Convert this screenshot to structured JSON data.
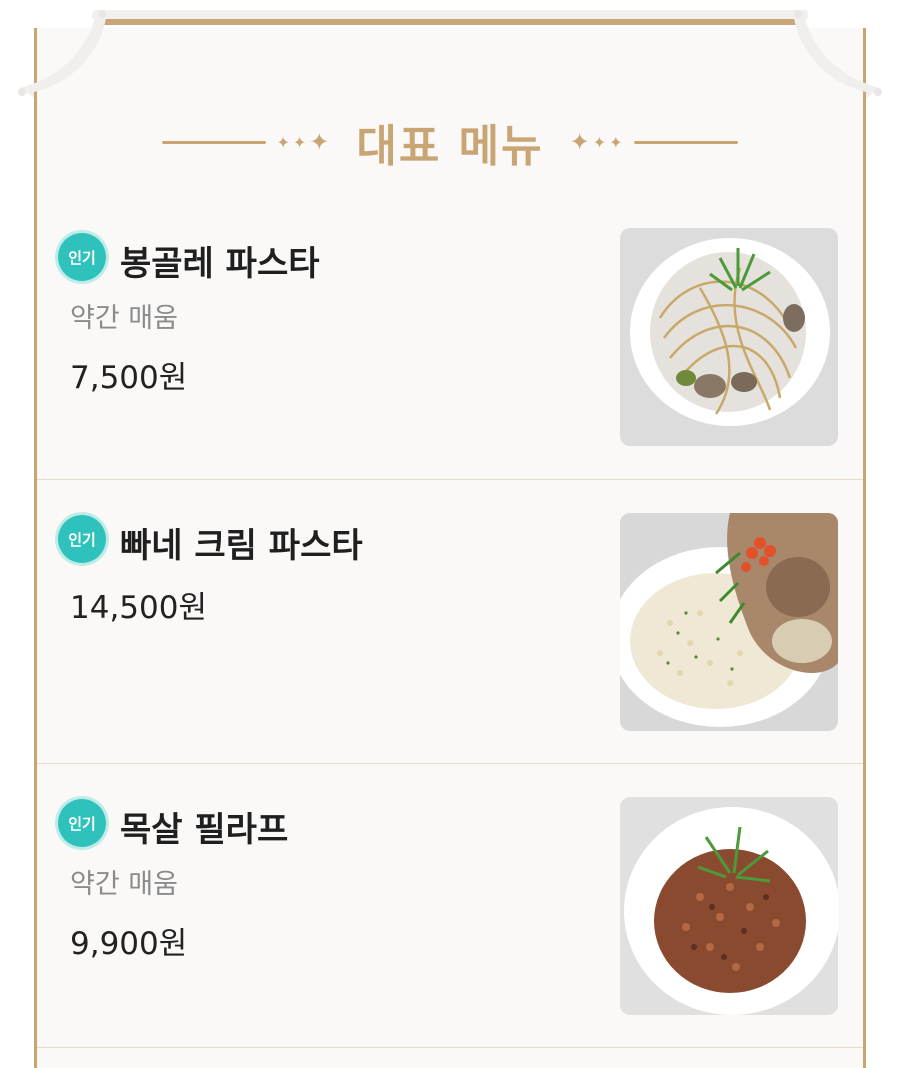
{
  "section": {
    "title": "대표 메뉴"
  },
  "menu_items": [
    {
      "badge": "인기",
      "name": "봉골레 파스타",
      "description": "약간 매움",
      "price": "7,500원",
      "photo_icon": "vongole-pasta-photo"
    },
    {
      "badge": "인기",
      "name": "빠네 크림 파스타",
      "description": "",
      "price": "14,500원",
      "photo_icon": "panne-cream-pasta-photo"
    },
    {
      "badge": "인기",
      "name": "목살 필라프",
      "description": "약간 매움",
      "price": "9,900원",
      "photo_icon": "pork-pilaf-photo"
    }
  ],
  "colors": {
    "accent": "#c9a574",
    "badge": "#2fc2bc",
    "text": "#1f1f1f",
    "muted": "#8b8b8b"
  }
}
